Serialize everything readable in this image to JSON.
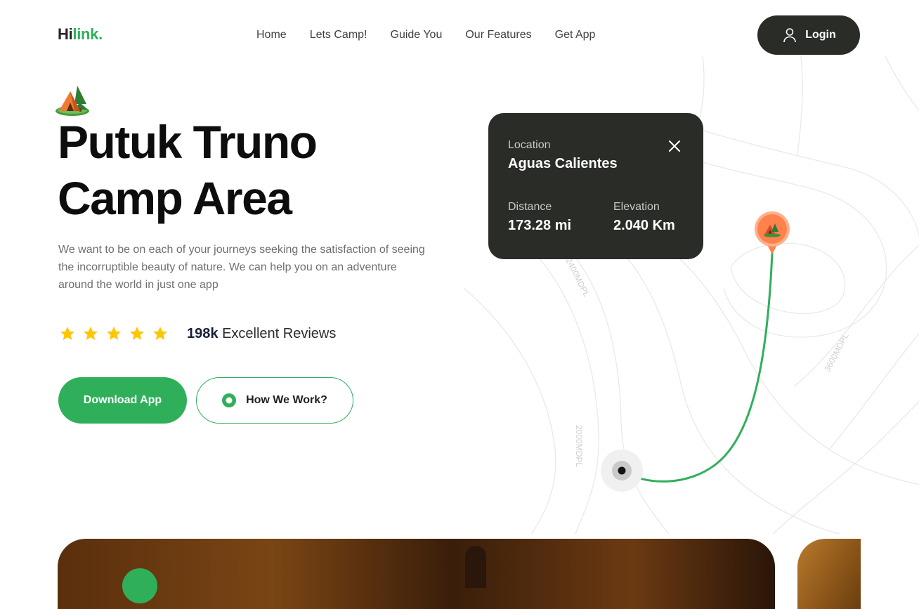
{
  "brand": {
    "part1": "Hi",
    "part2": "link."
  },
  "nav": {
    "items": [
      {
        "label": "Home"
      },
      {
        "label": "Lets Camp!"
      },
      {
        "label": "Guide You"
      },
      {
        "label": "Our Features"
      },
      {
        "label": "Get App"
      }
    ]
  },
  "header": {
    "login_label": "Login"
  },
  "hero": {
    "title_line1": "Putuk Truno",
    "title_line2": "Camp Area",
    "description": "We want to be on each of your journeys seeking the satisfaction of seeing the incorruptible beauty of nature. We can help you on an adventure around the world in just one app",
    "rating": 5,
    "reviews_count": "198k",
    "reviews_text": "Excellent Reviews",
    "download_label": "Download App",
    "how_label": "How We Work?"
  },
  "location_card": {
    "location_label": "Location",
    "location_name": "Aguas Calientes",
    "distance_label": "Distance",
    "distance_value": "173.28 mi",
    "elevation_label": "Elevation",
    "elevation_value": "2.040 Km"
  },
  "map": {
    "contour_labels": [
      "2400MDPL",
      "2000MDPL",
      "3600MDPL"
    ],
    "route_color": "#30af5b",
    "pin_color": "#ff814c"
  },
  "colors": {
    "accent": "#30af5b",
    "dark": "#292c27",
    "star": "#fec601"
  },
  "icons": {
    "login": "user-icon",
    "close": "close-icon",
    "play": "play-icon",
    "star": "star-icon",
    "camp": "camp-tent-icon"
  }
}
